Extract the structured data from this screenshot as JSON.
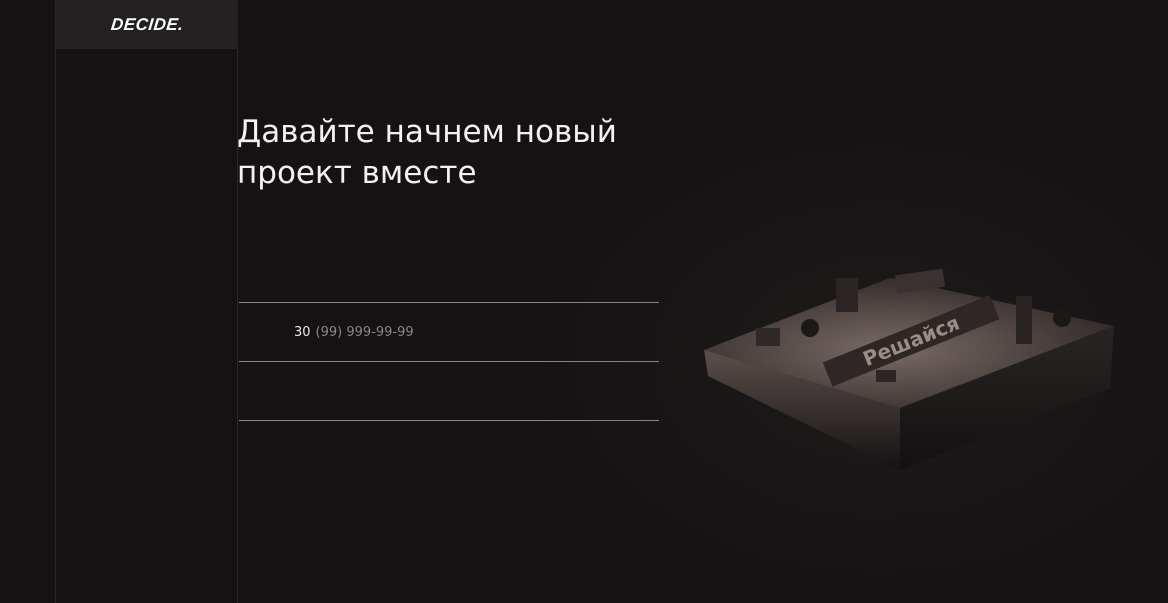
{
  "brand": {
    "logo": "DECIDE."
  },
  "hero": {
    "title_line1": "Давайте начнем новый",
    "title_line2": "проект вместе"
  },
  "form": {
    "name_value": "",
    "phone_code": "30",
    "phone_mask": "(99) 999-99-99",
    "email_value": ""
  },
  "illustration": {
    "icon": "3d-block-model-icon",
    "label": "Решайся"
  }
}
